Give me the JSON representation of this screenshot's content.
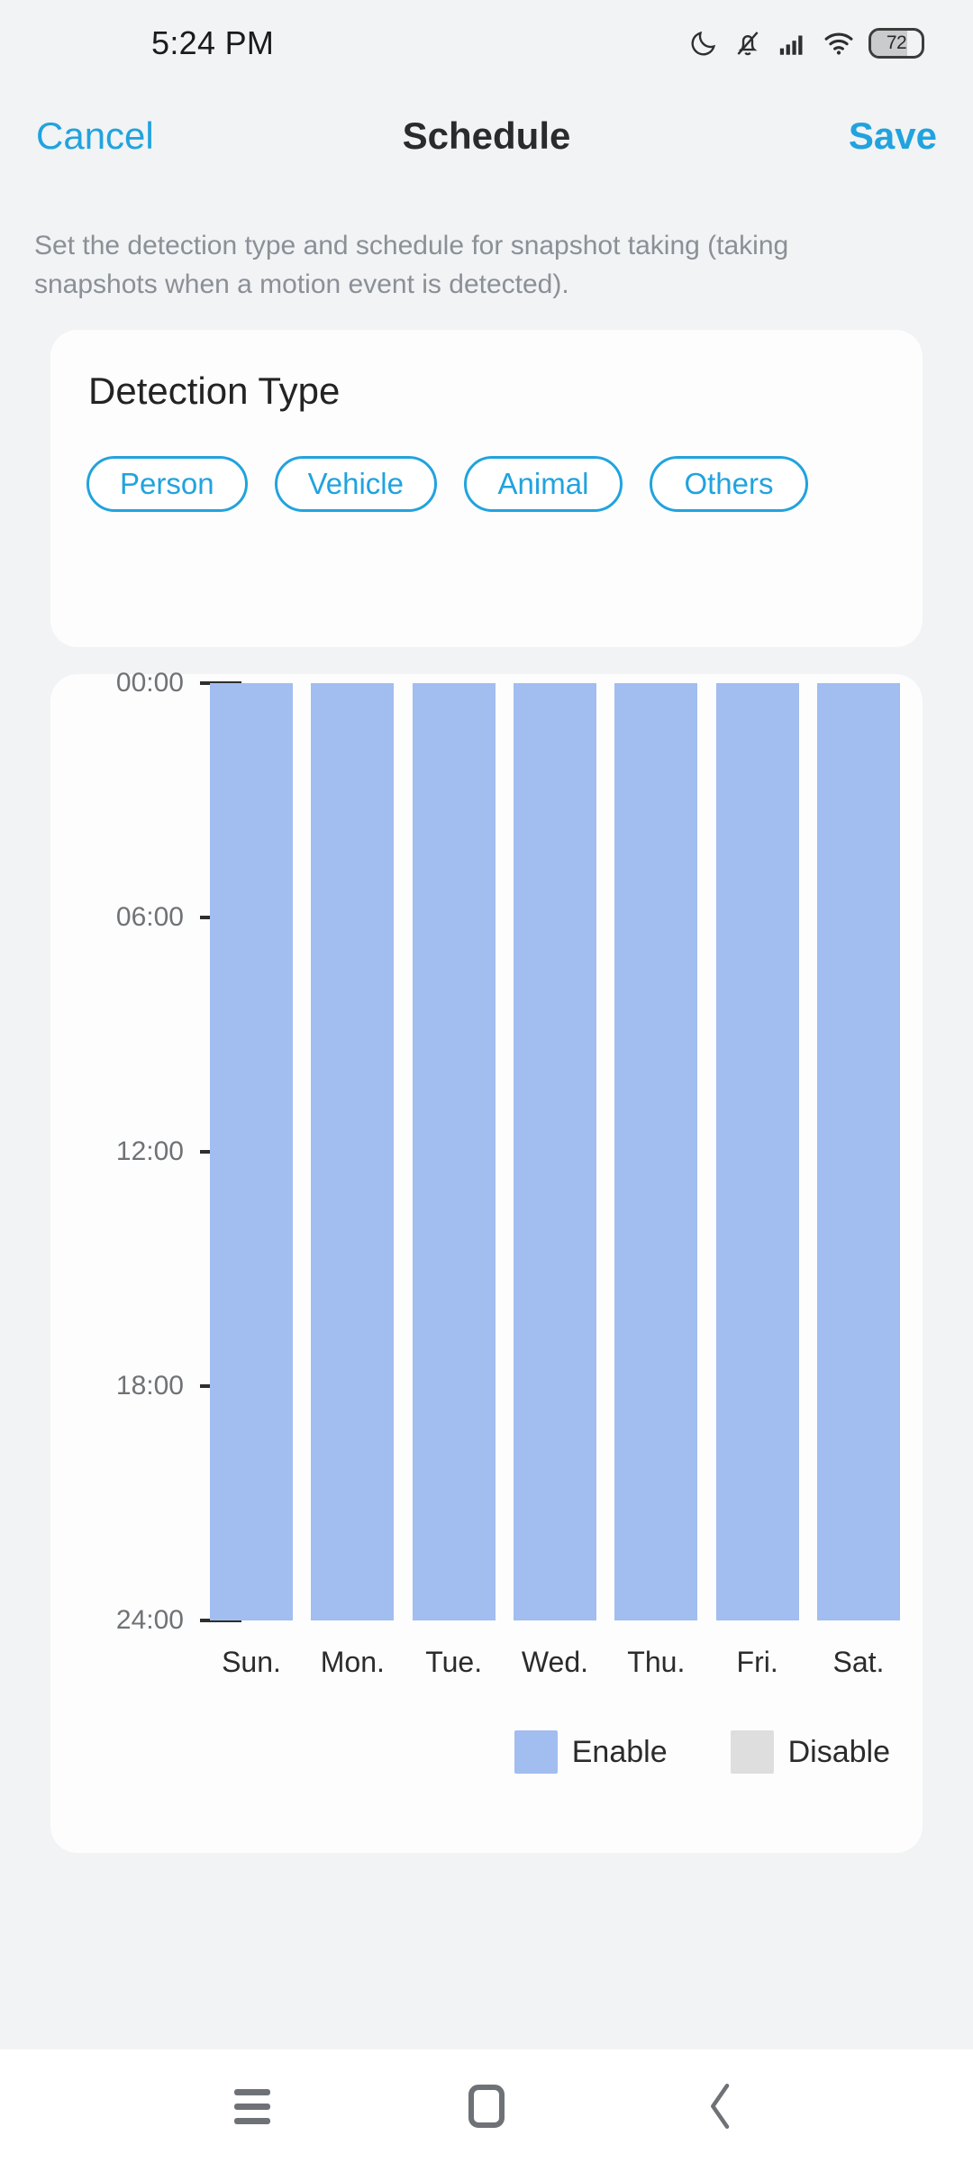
{
  "status_bar": {
    "time": "5:24 PM",
    "battery_level": "72",
    "icons": [
      "moon-icon",
      "bell-muted-icon",
      "cellular-signal-icon",
      "wifi-icon",
      "battery-icon"
    ]
  },
  "nav_bar": {
    "cancel_label": "Cancel",
    "title": "Schedule",
    "save_label": "Save"
  },
  "description": "Set the detection type and schedule for snapshot taking (taking snapshots when a motion event is detected).",
  "detection_type": {
    "title": "Detection Type",
    "chips": [
      {
        "label": "Person"
      },
      {
        "label": "Vehicle"
      },
      {
        "label": "Animal"
      },
      {
        "label": "Others"
      }
    ]
  },
  "colors": {
    "accent": "#21a3de",
    "enable": "#a2bdf0",
    "disable": "#dedede",
    "page_background": "#f1f3f5",
    "card_background": "#fdfdfd"
  },
  "chart_data": {
    "type": "bar",
    "title": "",
    "xlabel": "",
    "ylabel": "",
    "grid": false,
    "legend_position": "bottom-right",
    "categories": [
      "Sun.",
      "Mon.",
      "Tue.",
      "Wed.",
      "Thu.",
      "Fri.",
      "Sat."
    ],
    "y_tick_labels": [
      "00:00",
      "06:00",
      "12:00",
      "18:00",
      "24:00"
    ],
    "y_tick_values": [
      0,
      6,
      12,
      18,
      24
    ],
    "ylim": [
      0,
      24
    ],
    "y_axis_inverted": true,
    "legend": [
      {
        "name": "Enable",
        "color": "#a2bdf0"
      },
      {
        "name": "Disable",
        "color": "#dedede"
      }
    ],
    "series": [
      {
        "name": "Enable",
        "color": "#a2bdf0",
        "values": [
          {
            "day": "Sun.",
            "start": 0,
            "end": 24
          },
          {
            "day": "Mon.",
            "start": 0,
            "end": 24
          },
          {
            "day": "Tue.",
            "start": 0,
            "end": 24
          },
          {
            "day": "Wed.",
            "start": 0,
            "end": 24
          },
          {
            "day": "Thu.",
            "start": 0,
            "end": 24
          },
          {
            "day": "Fri.",
            "start": 0,
            "end": 24
          },
          {
            "day": "Sat.",
            "start": 0,
            "end": 24
          }
        ]
      }
    ]
  },
  "system_nav": {
    "recents_label": "recents",
    "home_label": "home",
    "back_label": "back"
  }
}
